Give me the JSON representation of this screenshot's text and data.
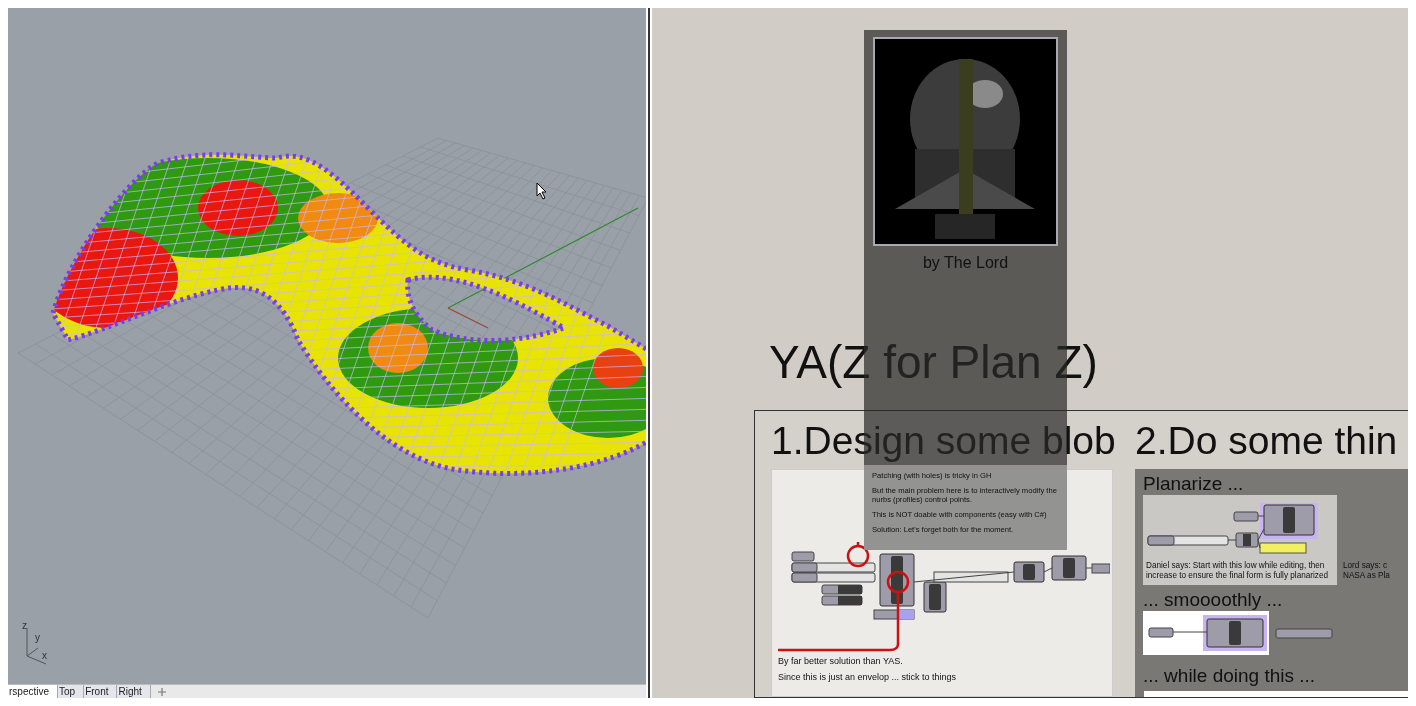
{
  "viewport": {
    "axes": [
      "z",
      "y",
      "x"
    ],
    "tabs": [
      {
        "label": "rspective",
        "selected": true
      },
      {
        "label": "Top",
        "selected": false
      },
      {
        "label": "Front",
        "selected": false
      },
      {
        "label": "Right",
        "selected": false
      }
    ]
  },
  "canvas": {
    "showcase": {
      "caption": "by The Lord",
      "note": [
        "Patching (with holes) is tricky in GH",
        "But the main problem here is to interactively modify the nurbs (profiles) control points.",
        "This is NOT doable with components (easy with C#)",
        "Solution: Let's forget both for the moment."
      ]
    },
    "title": "YA(Z for Plan Z)",
    "blob_section": {
      "heading": "1.Design some blob",
      "texts": [
        "By far better solution than YAS.",
        "Since this is just an envelop ... stick to things"
      ]
    },
    "steps_section": {
      "heading": "2.Do some thin",
      "planarize": {
        "heading": "Planarize ...",
        "caption": "Daniel says: Start with this low while editing, then increase to ensure the final form is fully planarized",
        "side_note": [
          "Lord  says: c",
          "NASA as Pla"
        ]
      },
      "smooth": {
        "heading": "... smoooothly ..."
      },
      "while": {
        "heading": "... while doing this  ..."
      }
    }
  }
}
